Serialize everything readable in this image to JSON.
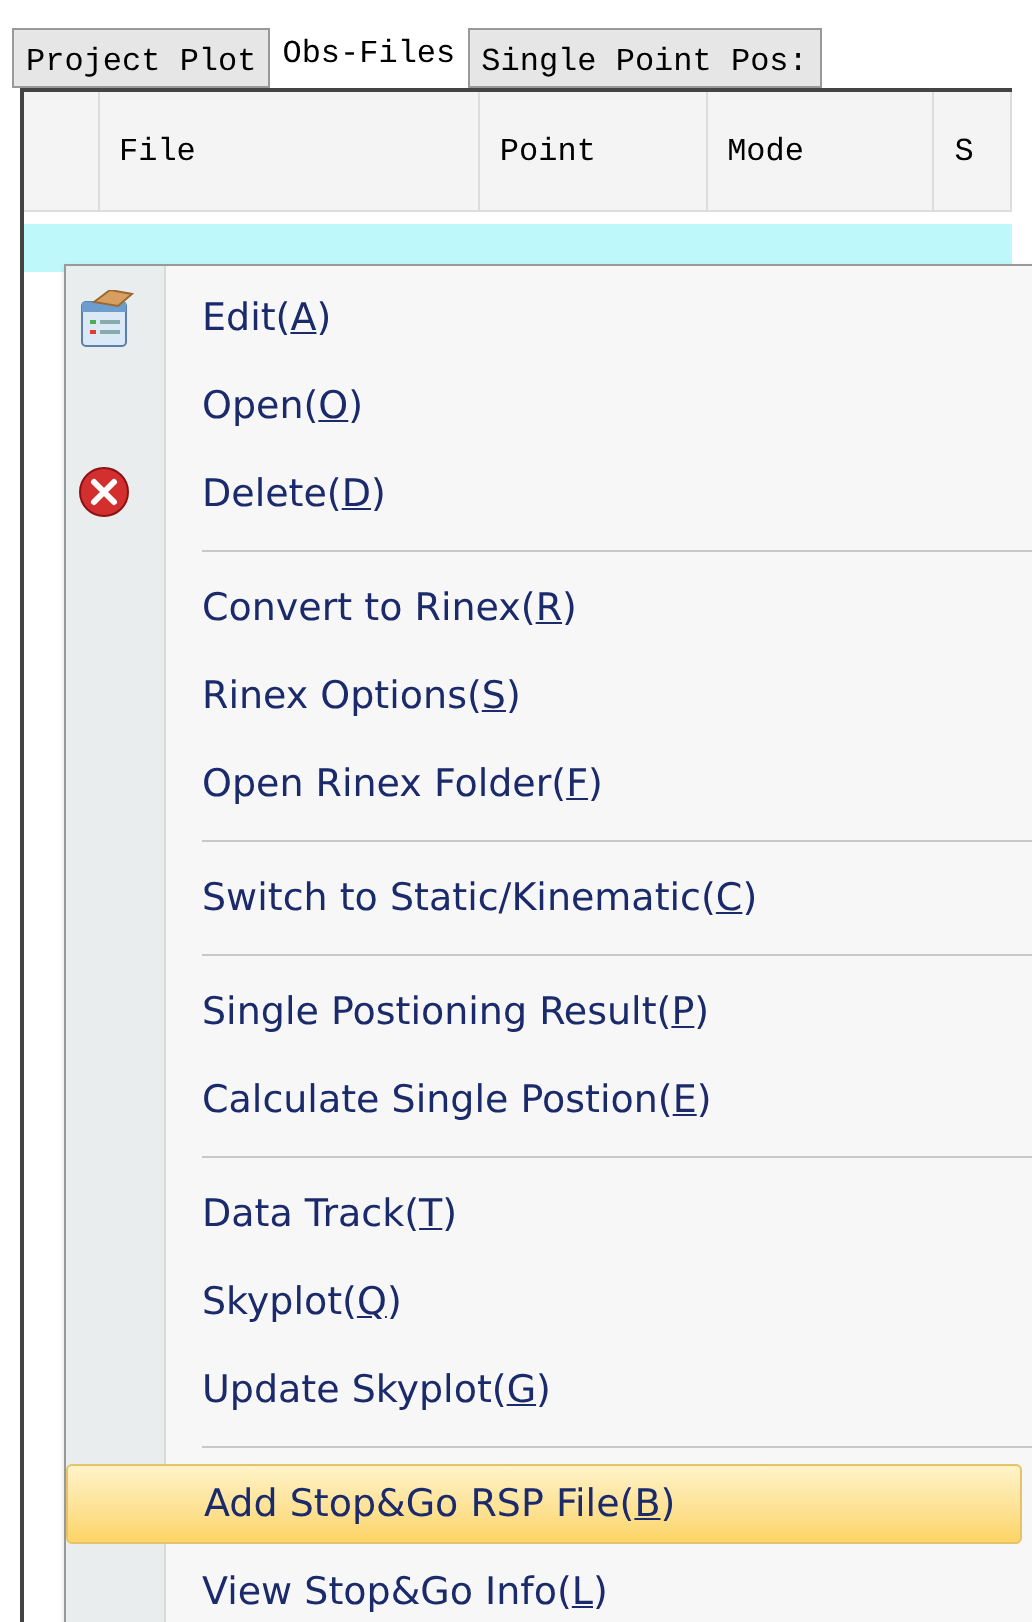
{
  "tabs": [
    {
      "label": "Project Plot",
      "selected": false
    },
    {
      "label": "Obs-Files",
      "selected": true
    },
    {
      "label": "Single Point Pos:",
      "selected": false
    }
  ],
  "table": {
    "columns": [
      "File",
      "Point",
      "Mode",
      "S"
    ],
    "rows": [
      {
        "selected": true
      }
    ]
  },
  "context_menu": {
    "items": [
      {
        "kind": "notepad",
        "label": "Edit(",
        "key": "A",
        "tail": ")",
        "highlighted": false
      },
      {
        "kind": "item",
        "label": "Open(",
        "key": "O",
        "tail": ")",
        "highlighted": false
      },
      {
        "kind": "delete",
        "label": "Delete(",
        "key": "D",
        "tail": ")",
        "highlighted": false
      },
      {
        "kind": "separator"
      },
      {
        "kind": "item",
        "label": "Convert to Rinex(",
        "key": "R",
        "tail": ")",
        "highlighted": false
      },
      {
        "kind": "item",
        "label": "Rinex Options(",
        "key": "S",
        "tail": ")",
        "highlighted": false
      },
      {
        "kind": "item",
        "label": "Open Rinex Folder(",
        "key": "F",
        "tail": ")",
        "highlighted": false
      },
      {
        "kind": "separator"
      },
      {
        "kind": "item",
        "label": "Switch to Static/Kinematic(",
        "key": "C",
        "tail": ")",
        "highlighted": false
      },
      {
        "kind": "separator"
      },
      {
        "kind": "item",
        "label": "Single Postioning Result(",
        "key": "P",
        "tail": ")",
        "highlighted": false
      },
      {
        "kind": "item",
        "label": "Calculate Single Postion(",
        "key": "E",
        "tail": ")",
        "highlighted": false
      },
      {
        "kind": "separator"
      },
      {
        "kind": "item",
        "label": "Data Track(",
        "key": "T",
        "tail": ")",
        "highlighted": false
      },
      {
        "kind": "item",
        "label": "Skyplot(",
        "key": "Q",
        "tail": ")",
        "highlighted": false
      },
      {
        "kind": "item",
        "label": "Update Skyplot(",
        "key": "G",
        "tail": ")",
        "highlighted": false
      },
      {
        "kind": "separator"
      },
      {
        "kind": "item",
        "label": "Add Stop&Go RSP File(",
        "key": "B",
        "tail": ")",
        "highlighted": true
      },
      {
        "kind": "item",
        "label": "View Stop&Go Info(",
        "key": "L",
        "tail": ")",
        "highlighted": false
      }
    ]
  }
}
